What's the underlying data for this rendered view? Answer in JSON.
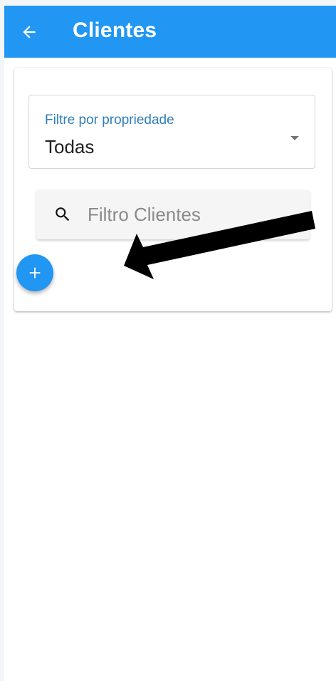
{
  "app_bar": {
    "title": "Clientes",
    "back_icon": "arrow-left-icon",
    "color": "#2196f3"
  },
  "filter": {
    "label": "Filtre por propriedade",
    "value": "Todas",
    "label_color": "#2f7fb8"
  },
  "search": {
    "placeholder": "Filtro Clientes",
    "icon": "search-icon"
  },
  "fab": {
    "icon": "plus-icon",
    "color": "#2196f3"
  },
  "annotation": {
    "type": "arrow",
    "color": "#000000",
    "points_to": "add-client-button"
  }
}
